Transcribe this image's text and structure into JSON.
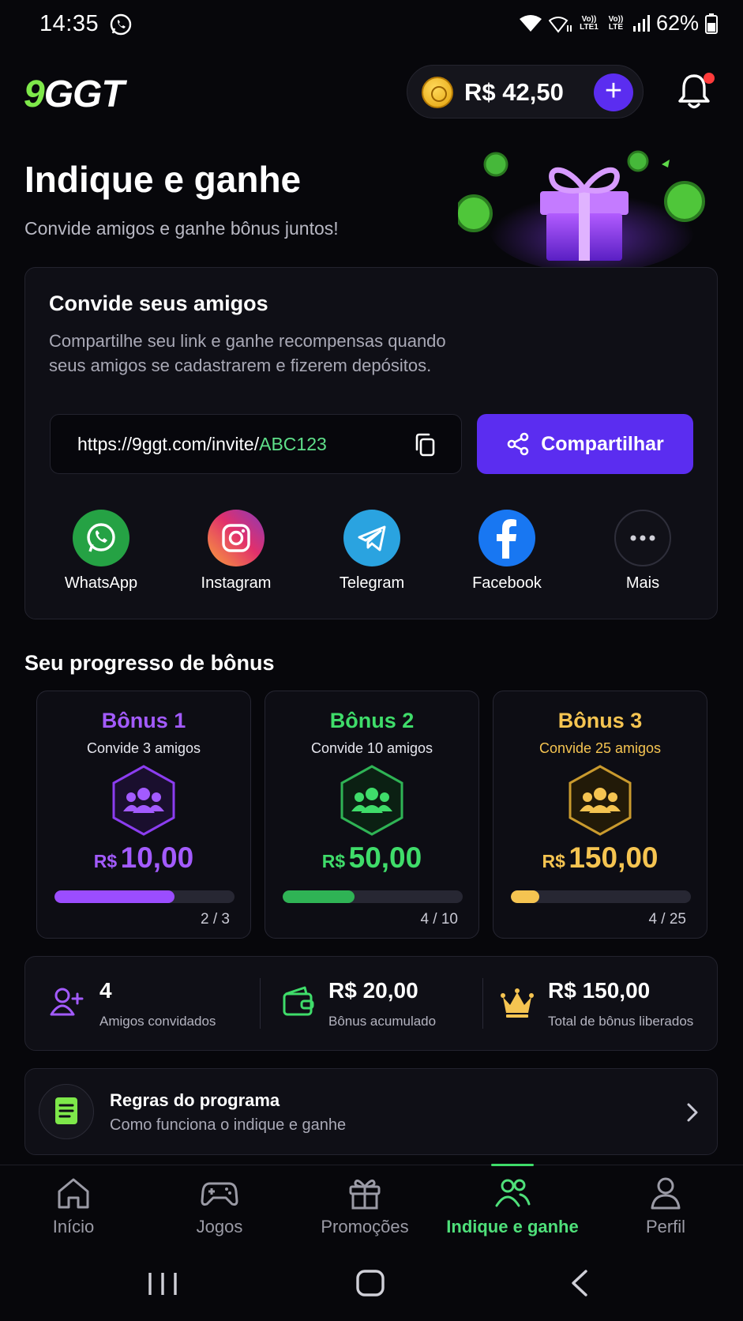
{
  "status_bar": {
    "time": "14:35",
    "battery": "62%",
    "lte1": "Vo)) LTE1",
    "lte2": "Vo)) LTE"
  },
  "header": {
    "logo": "9GGT",
    "balance": "R$ 42,50",
    "add_label": "+"
  },
  "hero": {
    "title": "Indique e ganhe",
    "subtitle": "Convide amigos e ganhe bônus juntos!"
  },
  "invite": {
    "title": "Convide seus amigos",
    "description": "Compartilhe seu link e ganhe recompensas quando seus amigos se cadastrarem e fizerem depósitos.",
    "link_prefix": "https://9ggt.com/invite/",
    "link_code": "ABC123",
    "share_label": "Compartilhar",
    "socials": [
      {
        "label": "WhatsApp",
        "icon": "whatsapp-icon",
        "color": "#25a244"
      },
      {
        "label": "Instagram",
        "icon": "instagram-icon",
        "color": "#e1306c"
      },
      {
        "label": "Telegram",
        "icon": "telegram-icon",
        "color": "#2aa3e0"
      },
      {
        "label": "Facebook",
        "icon": "facebook-icon",
        "color": "#1877f2"
      },
      {
        "label": "Mais",
        "icon": "more-icon",
        "color": "#1a1a22"
      }
    ]
  },
  "bonus": {
    "section_title": "Seu progresso de bônus",
    "cards": [
      {
        "title": "Bônus 1",
        "subtitle": "Convide 3 amigos",
        "currency": "R$",
        "amount_int": "10",
        "amount_dec": ",00",
        "progress": "2 / 3",
        "fraction": 0.6667,
        "color": "#9b4dff"
      },
      {
        "title": "Bônus 2",
        "subtitle": "Convide 10 amigos",
        "currency": "R$",
        "amount_int": "50",
        "amount_dec": ",00",
        "progress": "4 / 10",
        "fraction": 0.4,
        "color": "#3fdc6a"
      },
      {
        "title": "Bônus 3",
        "subtitle": "Convide 25 amigos",
        "currency": "R$",
        "amount_int": "150",
        "amount_dec": ",00",
        "progress": "4 / 25",
        "fraction": 0.16,
        "color": "#f5c451"
      }
    ]
  },
  "stats": [
    {
      "value": "4",
      "label": "Amigos convidados",
      "icon": "add-user-icon"
    },
    {
      "value": "R$ 20,00",
      "label": "Bônus acumulado",
      "icon": "wallet-icon"
    },
    {
      "value": "R$ 150,00",
      "label": "Total de bônus liberados",
      "icon": "crown-icon"
    }
  ],
  "rules": {
    "title": "Regras do programa",
    "subtitle": "Como funciona o indique e ganhe"
  },
  "nav": [
    {
      "label": "Início",
      "icon": "home-icon"
    },
    {
      "label": "Jogos",
      "icon": "gamepad-icon"
    },
    {
      "label": "Promoções",
      "icon": "gift-icon"
    },
    {
      "label": "Indique e ganhe",
      "icon": "users-icon",
      "active": true
    },
    {
      "label": "Perfil",
      "icon": "profile-icon"
    }
  ]
}
